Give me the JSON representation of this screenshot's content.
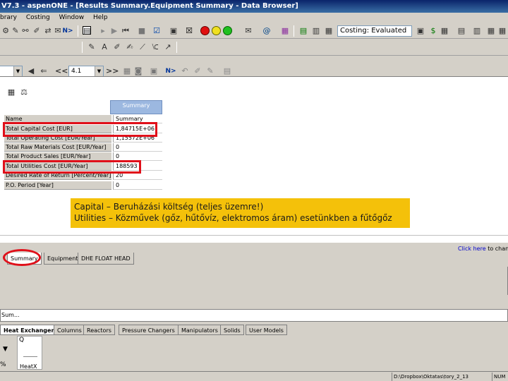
{
  "window": {
    "title": "V7.3 - aspenONE - [Results Summary.Equipment Summary - Data Browser]"
  },
  "menu": [
    "brary",
    "Costing",
    "Window",
    "Help"
  ],
  "toolbar": {
    "next_label": "N>",
    "costing_status": "Costing: Evaluated"
  },
  "browser_toolbar": {
    "back_label": "<<",
    "id_value": "4.1",
    "forward_label": ">>",
    "next_label": "N>"
  },
  "grid": {
    "column_header": "Summary",
    "rows": [
      {
        "label": "Name",
        "value": "Summary"
      },
      {
        "label": "Total Capital Cost [EUR]",
        "value": "1,84715E+06"
      },
      {
        "label": "Total Operating Cost [EUR/Year]",
        "value": "1,15572E+06"
      },
      {
        "label": "Total Raw Materials Cost [EUR/Year]",
        "value": "0"
      },
      {
        "label": "Total Product Sales [EUR/Year]",
        "value": "0"
      },
      {
        "label": "Total Utilities Cost [EUR/Year]",
        "value": "188593"
      },
      {
        "label": "Desired Rate of Return [Percent/Year]",
        "value": "20"
      },
      {
        "label": "P.O. Period [Year]",
        "value": "0"
      }
    ]
  },
  "callout": {
    "line1": "Capital – Beruházási költség (teljes üzemre!)",
    "line2": "Utilities – Közművek (gőz, hűtővíz, elektromos áram) esetünkben a fűtőgőz"
  },
  "click_here": {
    "link": "Click here",
    "rest": "to change"
  },
  "sheet_tabs": [
    "Summary",
    "Equipment",
    "DHE FLOAT HEAD"
  ],
  "side_label": "Sum...",
  "palette_tabs": [
    "Heat Exchangers",
    "Columns",
    "Reactors",
    "Pressure Changers",
    "Manipulators",
    "Solids",
    "User Models"
  ],
  "palette": {
    "block_label": "HeatX",
    "q_label": "Q",
    "pct_label": "%"
  },
  "status": {
    "path": "D:\\Dropbox\\Oktatas\\tory_2_13",
    "flag": "NUM"
  }
}
